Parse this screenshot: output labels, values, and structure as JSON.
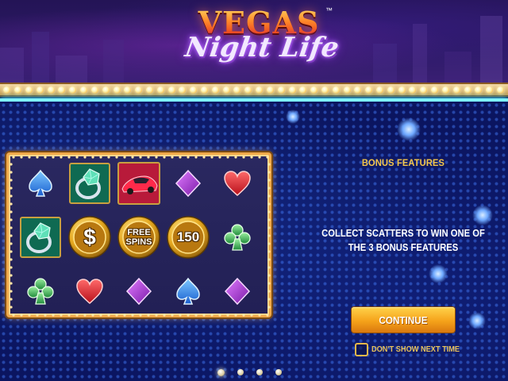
{
  "game": {
    "logo_word1": "VEGAS",
    "logo_trademark": "™",
    "logo_word2": "Night Life"
  },
  "info_page": {
    "title": "BONUS FEATURES",
    "description": "COLLECT SCATTERS TO WIN ONE OF THE 3 BONUS FEATURES",
    "continue_label": "CONTINUE",
    "dont_show_label": "DON'T SHOW NEXT TIME",
    "dont_show_checked": false,
    "pages_total": 4,
    "current_page": 1
  },
  "reels": {
    "rows": [
      [
        "spade",
        "diamond-ring",
        "red-sports-car",
        "diamond",
        "heart"
      ],
      [
        "diamond-ring",
        "dollar-coin",
        "free-spins-coin",
        "150-coin",
        "club"
      ],
      [
        "club",
        "heart",
        "diamond",
        "spade",
        "diamond"
      ]
    ],
    "coin_labels": {
      "dollar": "$",
      "free_spins_line1": "FREE",
      "free_spins_line2": "SPINS",
      "value": "150"
    }
  },
  "colors": {
    "accent_gold": "#f4c64a",
    "board_border": "#f0a94a",
    "neon_cyan": "#7ff5ff",
    "background_blue": "#0b1560"
  }
}
